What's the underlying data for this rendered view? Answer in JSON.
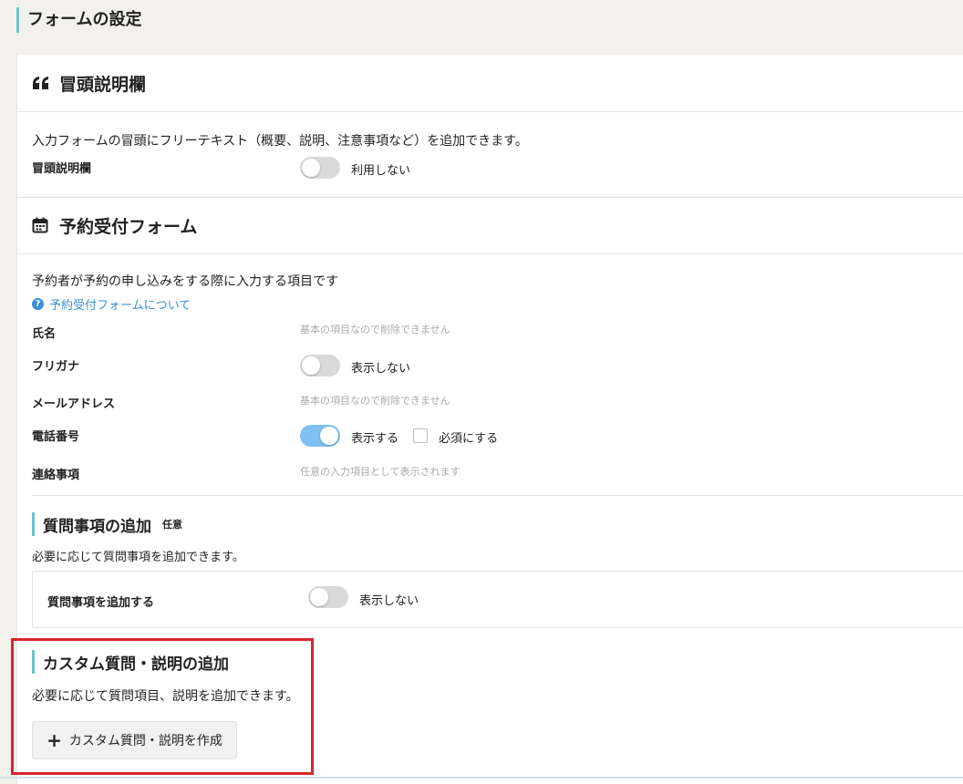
{
  "page_title": "フォームの設定",
  "intro_section": {
    "heading": "冒頭説明欄",
    "icon": "quote-icon",
    "description": "入力フォームの冒頭にフリーテキスト（概要、説明、注意事項など）を追加できます。",
    "field_label": "冒頭説明欄",
    "toggle_label": "利用しない",
    "toggle_on": false
  },
  "booking_section": {
    "heading": "予約受付フォーム",
    "icon": "calendar-icon",
    "description": "予約者が予約の申し込みをする際に入力する項目です",
    "help_link": "予約受付フォームについて",
    "fields": {
      "name": {
        "label": "氏名",
        "note": "基本の項目なので削除できません"
      },
      "furigana": {
        "label": "フリガナ",
        "toggle_label": "表示しない",
        "toggle_on": false
      },
      "email": {
        "label": "メールアドレス",
        "note": "基本の項目なので削除できません"
      },
      "phone": {
        "label": "電話番号",
        "toggle_label": "表示する",
        "toggle_on": true,
        "required_label": "必須にする",
        "required_checked": false
      },
      "contact": {
        "label": "連絡事項",
        "note": "任意の入力項目として表示されます"
      }
    }
  },
  "questions_section": {
    "heading": "質問事項の追加",
    "badge": "任意",
    "description": "必要に応じて質問事項を追加できます。",
    "field_label": "質問事項を追加する",
    "toggle_label": "表示しない",
    "toggle_on": false
  },
  "custom_section": {
    "heading": "カスタム質問・説明の追加",
    "description": "必要に応じて質問項目、説明を追加できます。",
    "button_label": "カスタム質問・説明を作成",
    "highlight_color": "#d7262c"
  },
  "colors": {
    "accent": "#6cc3cf",
    "toggle_on": "#7ec0ef",
    "link": "#3b8fd4"
  }
}
